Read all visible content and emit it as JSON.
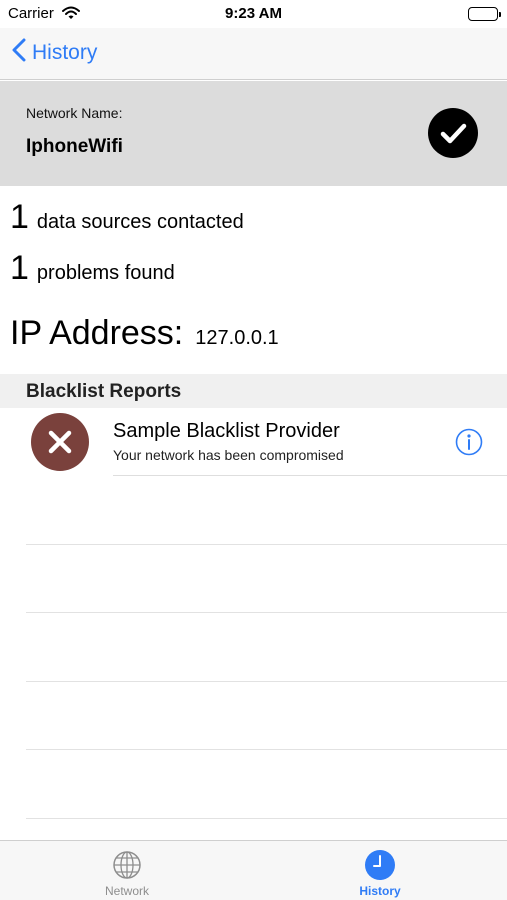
{
  "status_bar": {
    "carrier": "Carrier",
    "time": "9:23 AM",
    "icons": [
      "wifi-icon",
      "battery-icon"
    ]
  },
  "nav": {
    "back_label": "History",
    "back_icon": "chevron-left-icon",
    "accent_color": "#2f7cf6"
  },
  "network": {
    "name_label": "Network Name:",
    "name_value": "IphoneWifi",
    "status_icon": "checkmark-circle-icon"
  },
  "stats": {
    "sources_count": "1",
    "sources_label": "data sources contacted",
    "problems_count": "1",
    "problems_label": "problems found"
  },
  "ip": {
    "label": "IP Address:",
    "value": "127.0.0.1"
  },
  "blacklist": {
    "section_title": "Blacklist Reports",
    "reports": [
      {
        "title": "Sample Blacklist Provider",
        "subtitle": "Your network has been compromised",
        "status_icon": "error-x-icon",
        "status_color": "#7a413c",
        "action_icon": "info-icon"
      }
    ]
  },
  "tab_bar": {
    "tabs": [
      {
        "label": "Network",
        "icon": "globe-icon",
        "selected": false
      },
      {
        "label": "History",
        "icon": "clock-icon",
        "selected": true
      }
    ]
  }
}
